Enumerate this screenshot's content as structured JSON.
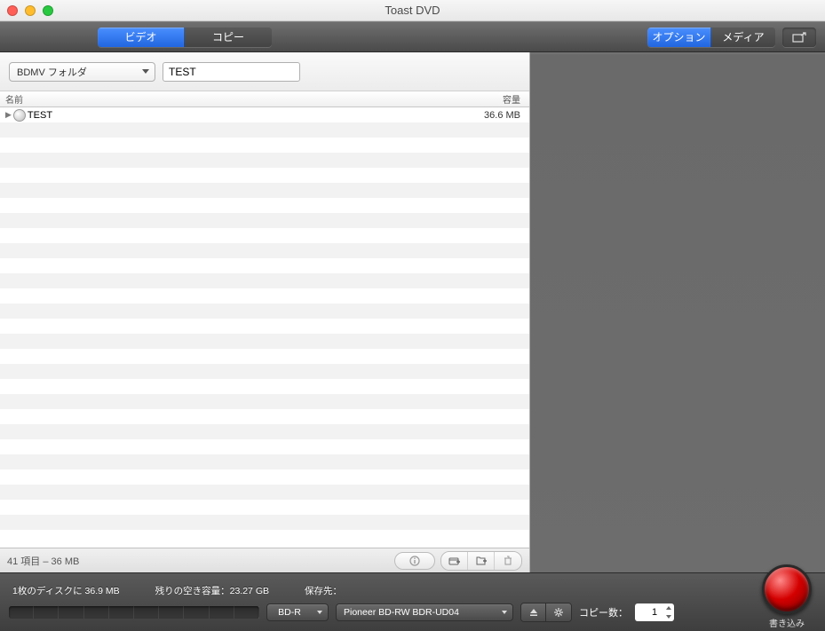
{
  "window": {
    "title": "Toast DVD"
  },
  "toolbar": {
    "left": {
      "video": "ビデオ",
      "copy": "コピー"
    },
    "right": {
      "option": "オプション",
      "media": "メディア"
    }
  },
  "controls": {
    "folder_type": "BDMV フォルダ",
    "name_value": "TEST"
  },
  "columns": {
    "name": "名前",
    "size": "容量"
  },
  "items": [
    {
      "name": "TEST",
      "size": "36.6 MB"
    }
  ],
  "footer": {
    "summary": "41 項目 – 36 MB"
  },
  "bottom": {
    "disc_info": "1枚のディスクに 36.9 MB",
    "remaining": "残りの空き容量：23.27 GB",
    "save_to": "保存先：",
    "disc_type": "BD-R",
    "drive": "Pioneer BD-RW   BDR-UD04",
    "copies_label": "コピー数：",
    "copies_value": "1",
    "burn_label": "書き込み"
  }
}
